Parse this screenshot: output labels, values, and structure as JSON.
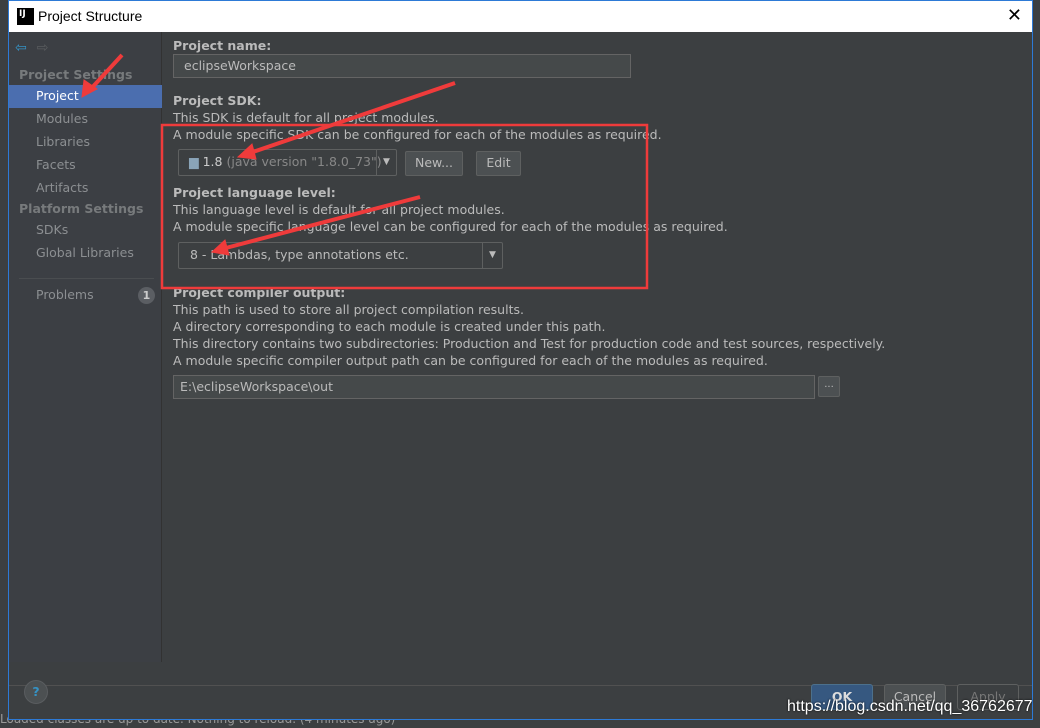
{
  "window": {
    "title": "Project Structure",
    "logo": "IJ",
    "close": "✕"
  },
  "sidebar": {
    "back": "⇦",
    "forward": "⇨",
    "project_settings": "Project Settings",
    "platform_settings": "Platform Settings",
    "items": [
      {
        "label": "Project"
      },
      {
        "label": "Modules"
      },
      {
        "label": "Libraries"
      },
      {
        "label": "Facets"
      },
      {
        "label": "Artifacts"
      }
    ],
    "platform_items": [
      {
        "label": "SDKs"
      },
      {
        "label": "Global Libraries"
      }
    ],
    "problems": {
      "label": "Problems",
      "count": "1"
    }
  },
  "main": {
    "project_name": {
      "label": "Project name:",
      "value": "eclipseWorkspace"
    },
    "sdk": {
      "label": "Project SDK:",
      "desc1": "This SDK is default for all project modules.",
      "desc2": "A module specific SDK can be configured for each of the modules as required.",
      "version": "1.8",
      "detail": "(java version \"1.8.0_73\")",
      "new_label": "New...",
      "edit_label": "Edit"
    },
    "language": {
      "label": "Project language level:",
      "desc1": "This language level is default for all project modules.",
      "desc2": "A module specific language level can be configured for each of the modules as required.",
      "value": "8 - Lambdas, type annotations etc."
    },
    "compiler": {
      "label": "Project compiler output:",
      "desc1": "This path is used to store all project compilation results.",
      "desc2": "A directory corresponding to each module is created under this path.",
      "desc3": "This directory contains two subdirectories: Production and Test for production code and test sources, respectively.",
      "desc4": "A module specific compiler output path can be configured for each of the modules as required.",
      "value": "E:\\eclipseWorkspace\\out",
      "browse": "..."
    }
  },
  "footer": {
    "help": "?",
    "ok": "OK",
    "cancel": "Cancel",
    "apply": "Apply"
  },
  "status_bar": "Loaded classes are up to date. Nothing to reload. (4 minutes ago)",
  "watermark": "https://blog.csdn.net/qq_36762677",
  "colors": {
    "selection": "#4b6eaf",
    "annotation": "#ef3b3b"
  }
}
